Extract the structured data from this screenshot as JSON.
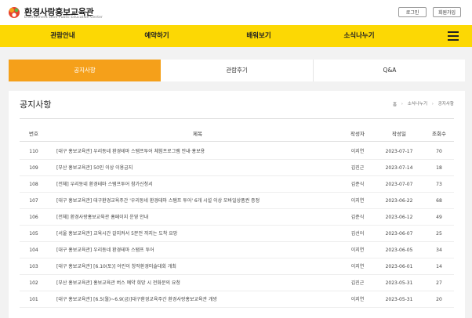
{
  "header": {
    "logo_title": "환경사랑홍보교육관",
    "logo_subtitle": "Environment Love Public Education Center",
    "login_label": "로그인",
    "join_label": "회원가입"
  },
  "nav": {
    "items": [
      {
        "label": "관람안내"
      },
      {
        "label": "예약하기"
      },
      {
        "label": "배워보기"
      },
      {
        "label": "소식나누기"
      }
    ]
  },
  "tabs": [
    {
      "label": "공지사항",
      "active": true
    },
    {
      "label": "관람후기",
      "active": false
    },
    {
      "label": "Q&A",
      "active": false
    }
  ],
  "page": {
    "title": "공지사항",
    "breadcrumb": [
      "홈",
      "소식나누기",
      "공지사항"
    ]
  },
  "table": {
    "columns": [
      "번호",
      "제목",
      "작성자",
      "작성일",
      "조회수"
    ],
    "rows": [
      {
        "num": "110",
        "title": "[대구 홍보교육관] 우리동네 환경테마 스탬프투어 체험프로그램 안내·홍보용",
        "author": "이지연",
        "date": "2023-07-17",
        "views": "70"
      },
      {
        "num": "109",
        "title": "[부산 홍보교육관] 50인 이상 이용금지",
        "author": "김진근",
        "date": "2023-07-14",
        "views": "18"
      },
      {
        "num": "108",
        "title": "[전체] 우리동네 환경테마 스탬프투어 참가신청서",
        "author": "김준식",
        "date": "2023-07-07",
        "views": "73"
      },
      {
        "num": "107",
        "title": "[대구 홍보교육관] 대구환경교육주간 '우리동네 환경테마 스탬프 투어' 6개 시설 이상 모바일상품권 증정",
        "author": "이지연",
        "date": "2023-06-22",
        "views": "68"
      },
      {
        "num": "106",
        "title": "[전체] 환경사랑홍보교육관 홈페이지 운영 안내",
        "author": "김준식",
        "date": "2023-06-12",
        "views": "49"
      },
      {
        "num": "105",
        "title": "[서울 홍보교육관] 교육시간 갈지켜서 5분전 까지는 도착 요망",
        "author": "김선어",
        "date": "2023-06-07",
        "views": "25"
      },
      {
        "num": "104",
        "title": "[대구 홍보교육관] 우리동네 환경테마 스탬프 투어",
        "author": "이지연",
        "date": "2023-06-05",
        "views": "34"
      },
      {
        "num": "103",
        "title": "[대구 홍보교육관] [6.10(토)] 어린이 창작환경미술대회 개최",
        "author": "이지연",
        "date": "2023-06-01",
        "views": "14"
      },
      {
        "num": "102",
        "title": "[부산 홍보교육관] 홍보교육관 버스 예약 희망 시 전화문의 요청",
        "author": "김진근",
        "date": "2023-05-31",
        "views": "27"
      },
      {
        "num": "101",
        "title": "[대구 홍보교육관] [6.5(월)~6.9(금)]대구환경교육주간 환경사랑홍보교육관 개방",
        "author": "이지연",
        "date": "2023-05-31",
        "views": "20"
      }
    ]
  },
  "colors": {
    "nav_bg": "#fcd804",
    "active_tab": "#f5a01a",
    "logo_red": "#e8412c",
    "logo_orange": "#f5a01a"
  }
}
